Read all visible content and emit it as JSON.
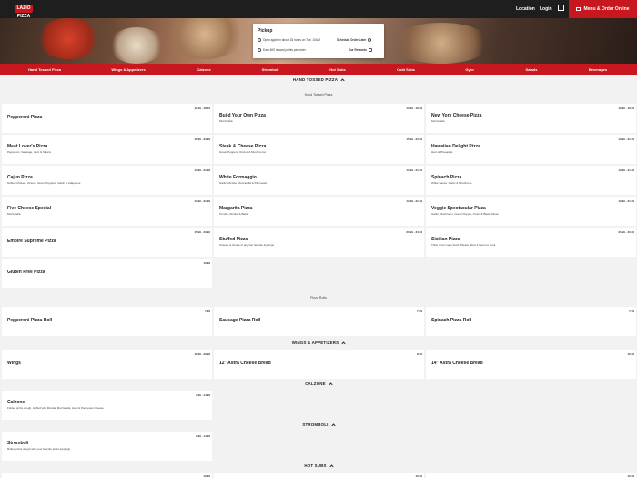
{
  "brand": {
    "logo_text": "LAZIO PIZZA",
    "accent": "#c8171e"
  },
  "topnav": {
    "location": "Location",
    "login": "Login",
    "order_button": "Menu & Order Online"
  },
  "pickup": {
    "title": "Pickup",
    "open_text": "Open again in about 18 hours on Tue, 10AM",
    "schedule": "Schedule Order Later",
    "rewards_text": "Earn 600 reward points per order",
    "rewards_link": "Our Rewards"
  },
  "categories": [
    "Hand Tossed Pizza",
    "Wings & Appetizers",
    "Calzone",
    "Stromboli",
    "Hot Subs",
    "Cold Subs",
    "Gyro",
    "Salads",
    "Beverages"
  ],
  "sections": {
    "hand_tossed": "HAND TOSSED PIZZA",
    "hand_tossed_sub": "Hand Tossed Pizza",
    "pizza_rolls_sub": "Pizza Rolls",
    "wings": "WINGS & APPETIZERS",
    "calzone": "CALZONE",
    "stromboli": "STROMBOLI",
    "hot_subs": "HOT SUBS"
  },
  "items": {
    "pepperoni_pizza": {
      "name": "Pepperoni Pizza",
      "price": "12.49 - 18.49",
      "desc": ""
    },
    "build_your_own": {
      "name": "Build Your Own Pizza",
      "price": "10.99 - 16.99",
      "desc": "Mozzarella"
    },
    "new_york_cheese": {
      "name": "New York Cheese Pizza",
      "price": "10.99 - 16.99",
      "desc": "Mozzarella"
    },
    "meat_lovers": {
      "name": "Meat Lover's Pizza",
      "price": "15.99 - 23.99",
      "desc": "Pepperoni, Sausage, Ham & Salami"
    },
    "steak_cheese": {
      "name": "Steak & Cheese Pizza",
      "price": "15.99 - 23.99",
      "desc": "Green Peppers, Onions & Mushrooms"
    },
    "hawaiian": {
      "name": "Hawaiian Delight Pizza",
      "price": "13.99 - 21.99",
      "desc": "Ham & Pineapple"
    },
    "cajun": {
      "name": "Cajun Pizza",
      "price": "13.99 - 21.99",
      "desc": "Grilled Chicken, Onions, Green Peppers, Garlic & Jalapenos"
    },
    "white_formaggio": {
      "name": "White Formaggio",
      "price": "13.99 - 21.99",
      "desc": "Garlic, Ricotta, Mozzarella & Parmesan"
    },
    "spinach": {
      "name": "Spinach Pizza",
      "price": "13.99 - 21.99",
      "desc": "White Sauce, Garlic & Mushroom"
    },
    "five_cheese": {
      "name": "Five Cheese Special",
      "price": "13.99 - 21.99",
      "desc": "Mozzarella"
    },
    "margarita": {
      "name": "Margarita Pizza",
      "price": "13.99 - 21.99",
      "desc": "Tomato, Ricotta & Basil"
    },
    "veggie": {
      "name": "Veggie Spectacular Pizza",
      "price": "13.99 - 21.99",
      "desc": "Garlic, Mushroom, Green Pepper, Onion & Black Olives"
    },
    "empire_supreme": {
      "name": "Empire Supreme Pizza",
      "price": "15.99 - 23.99",
      "desc": ""
    },
    "stuffed": {
      "name": "Stuffed Pizza",
      "price": "21.99 - 24.99",
      "desc": "Cheese & choice of any two favorite toppings"
    },
    "sicilian": {
      "name": "Sicilian Pizza",
      "price": "21.99 - 23.99",
      "desc": "Thick crust made fresh. Please allow 2 hours to cook"
    },
    "gluten_free": {
      "name": "Gluten Free Pizza",
      "price": "13.99",
      "desc": ""
    },
    "pepperoni_roll": {
      "name": "Pepperoni Pizza Roll",
      "price": "7.99",
      "desc": ""
    },
    "sausage_roll": {
      "name": "Sausage Pizza Roll",
      "price": "7.99",
      "desc": ""
    },
    "spinach_roll": {
      "name": "Spinach Pizza Roll",
      "price": "7.99",
      "desc": ""
    },
    "wings": {
      "name": "Wings",
      "price": "11.99 - 20.99",
      "desc": ""
    },
    "astra_12": {
      "name": "12\" Astra Cheese Bread",
      "price": "8.99",
      "desc": ""
    },
    "astra_14": {
      "name": "14\" Astra Cheese Bread",
      "price": "10.99",
      "desc": ""
    },
    "calzone": {
      "name": "Calzone",
      "price": "7.99 - 14.99",
      "desc": "Folded pizza dough, stuffed with Ricotta, Mozzarella, Ham & Parmesan Cheese"
    },
    "stromboli": {
      "name": "Stromboli",
      "price": "7.99 - 14.99",
      "desc": "Rolled pizza dough with your favorite pizza toppings"
    },
    "hotsub1": {
      "name": "",
      "price": "10.99",
      "desc": ""
    },
    "hotsub2": {
      "name": "",
      "price": "10.99",
      "desc": ""
    },
    "hotsub3": {
      "name": "",
      "price": "10.99",
      "desc": ""
    }
  }
}
